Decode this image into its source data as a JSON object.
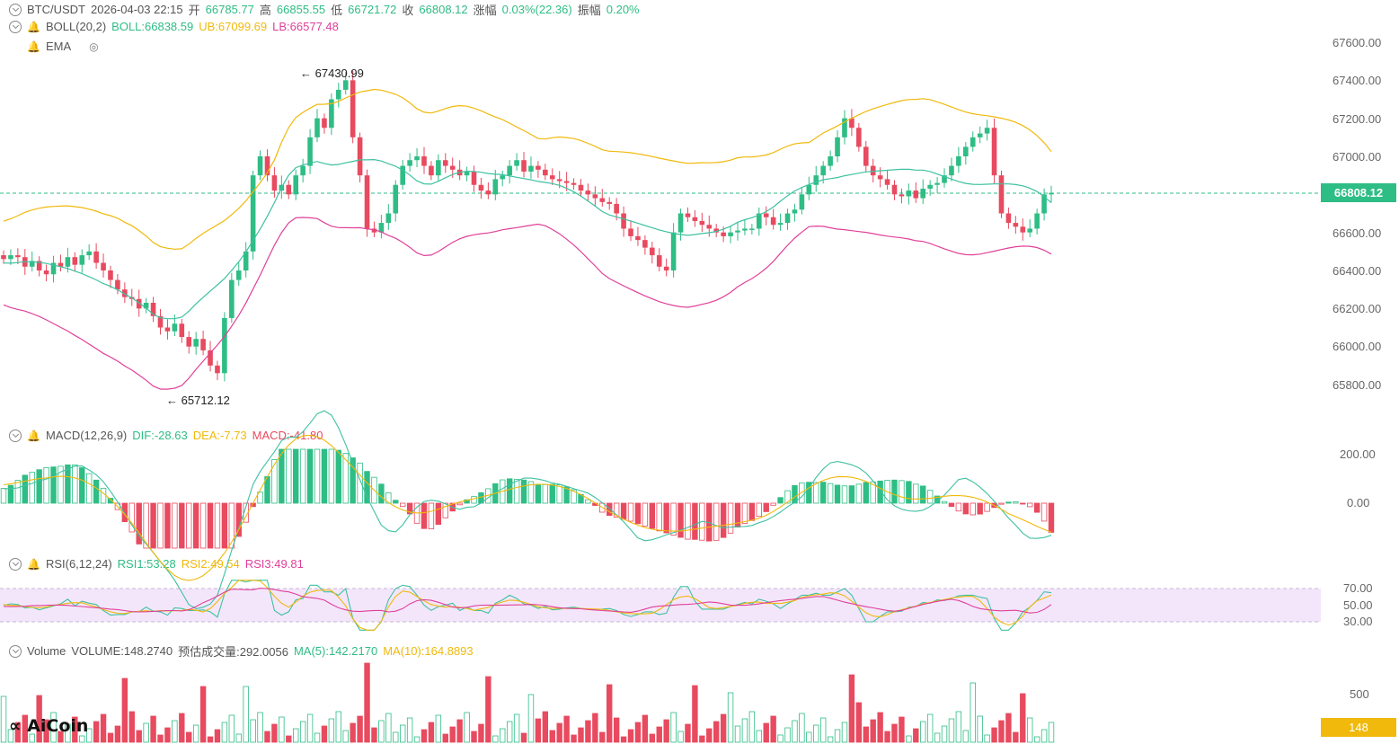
{
  "header": {
    "pair": "BTC/USDT",
    "datetime": "2026-04-03 22:15",
    "open_label": "开",
    "open": "66785.77",
    "high_label": "高",
    "high": "66855.55",
    "low_label": "低",
    "low": "66721.72",
    "close_label": "收",
    "close": "66808.12",
    "change_label": "涨幅",
    "change": "0.03%(22.36)",
    "amp_label": "振幅",
    "amp": "0.20%"
  },
  "boll": {
    "name": "BOLL(20,2)",
    "mid": "BOLL:66838.59",
    "ub": "UB:67099.69",
    "lb": "LB:66577.48"
  },
  "ema": {
    "name": "EMA"
  },
  "macd": {
    "name": "MACD(12,26,9)",
    "dif": "DIF:-28.63",
    "dea": "DEA:-7.73",
    "macd": "MACD:-41.80"
  },
  "rsi": {
    "name": "RSI(6,12,24)",
    "rsi1": "RSI1:53.28",
    "rsi2": "RSI2:49.54",
    "rsi3": "RSI3:49.81"
  },
  "volume": {
    "name": "Volume",
    "volume": "VOLUME:148.2740",
    "est": "预估成交量:292.0056",
    "ma5": "MA(5):142.2170",
    "ma10": "MA(10):164.8893"
  },
  "price_axis": [
    "67600.00",
    "67400.00",
    "67200.00",
    "67000.00",
    "66600.00",
    "66400.00",
    "66200.00",
    "66000.00",
    "65800.00"
  ],
  "current_price": "66808.12",
  "macd_axis": [
    "200.00",
    "0.00"
  ],
  "rsi_axis": [
    "70.00",
    "50.00",
    "30.00"
  ],
  "volume_axis": [
    "500"
  ],
  "current_volume": "148",
  "annotations": {
    "high": "67430.99",
    "low": "65712.12"
  },
  "logo": "AiCoin",
  "colors": {
    "up": "#2ebd85",
    "down": "#e84a5f",
    "mid": "#3ec1a1",
    "ub": "#f0b90b",
    "lb": "#e0409a"
  }
}
